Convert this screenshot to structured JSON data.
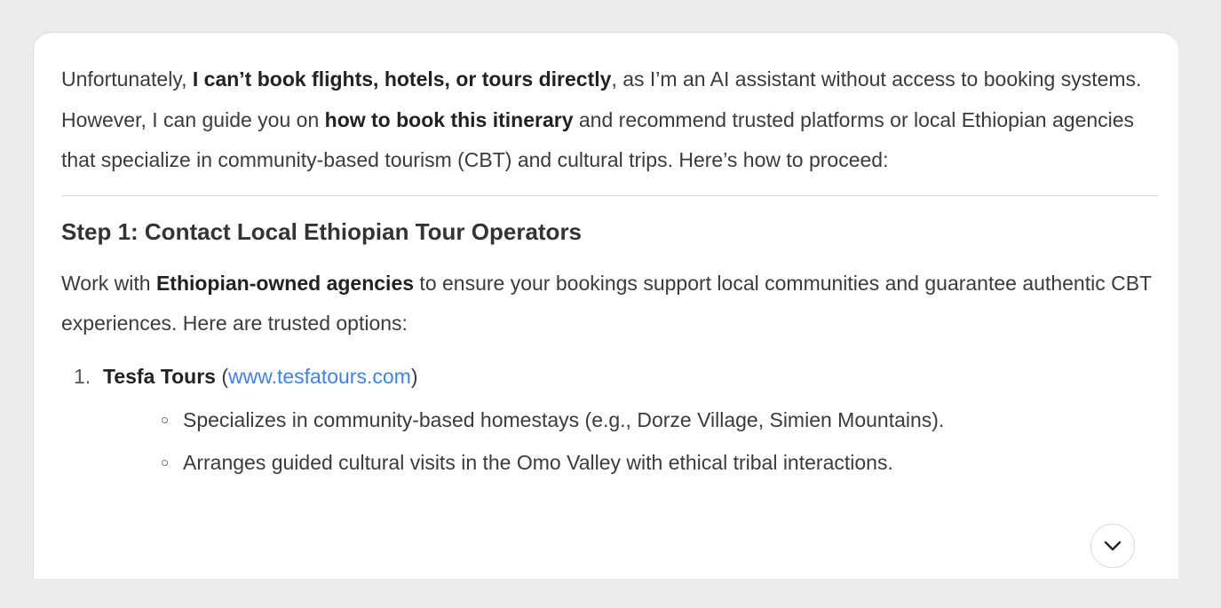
{
  "intro": {
    "text1": "Unfortunately, ",
    "bold1": "I can’t book flights, hotels, or tours directly",
    "text2": ", as I’m an AI assistant without access to booking systems. However, I can guide you on ",
    "bold2": "how to book this itinerary",
    "text3": " and recommend trusted platforms or local Ethiopian agencies that specialize in community-based tourism (CBT) and cultural trips. Here’s how to proceed:"
  },
  "step1": {
    "heading": "Step 1: Contact Local Ethiopian Tour Operators",
    "text1": "Work with ",
    "bold1": "Ethiopian-owned agencies",
    "text2": " to ensure your bookings support local communities and guarantee authentic CBT experiences. Here are trusted options:"
  },
  "operators": [
    {
      "number": "1.",
      "name": "Tesfa Tours",
      "open_paren": " (",
      "url": "www.tesfatours.com",
      "close_paren": ")",
      "details": [
        "Specializes in community-based homestays (e.g., Dorze Village, Simien Mountains).",
        "Arranges guided cultural visits in the Omo Valley with ethical tribal interactions."
      ]
    }
  ],
  "scroll_button": {
    "icon": "chevron-down-icon"
  },
  "colors": {
    "background": "#ececec",
    "card": "#ffffff",
    "text": "#3b3b3b",
    "link": "#3b82f6"
  }
}
